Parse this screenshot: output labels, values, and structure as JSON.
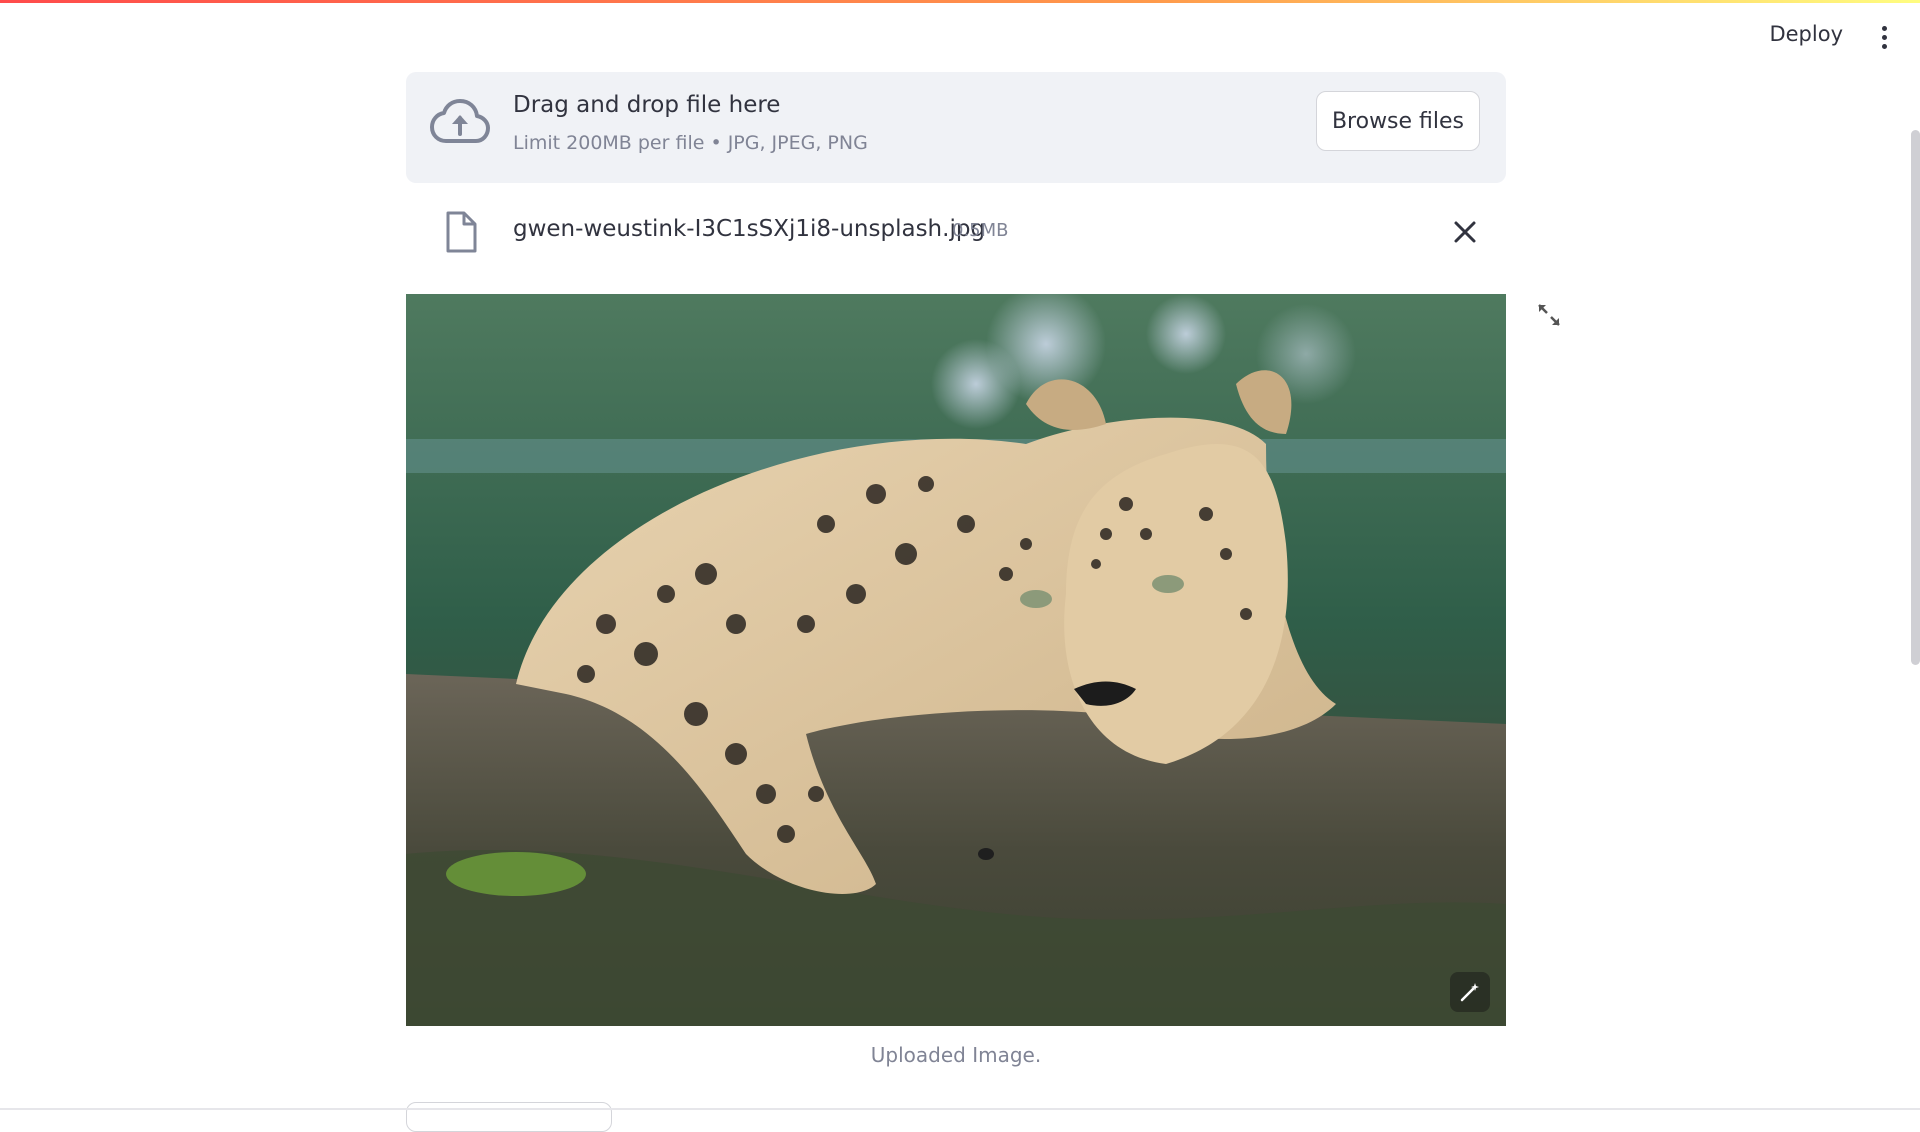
{
  "header": {
    "deploy_label": "Deploy",
    "menu_icon": "kebab-menu-icon"
  },
  "uploader": {
    "icon": "cloud-upload-icon",
    "title": "Drag and drop file here",
    "limits": "Limit 200MB per file • JPG, JPEG, PNG",
    "browse_label": "Browse files"
  },
  "file": {
    "icon": "file-icon",
    "name": "gwen-weustink-I3C1sSXj1i8-unsplash.jpg",
    "size": "0.5MB",
    "remove_icon": "close-icon"
  },
  "image": {
    "alt": "leopard resting on log",
    "caption": "Uploaded Image.",
    "fullscreen_icon": "expand-icon",
    "edit_icon": "magic-wand-icon"
  },
  "colors": {
    "accent_gradient_start": "#ff4b4b",
    "accent_gradient_end": "#fffd80",
    "text": "#31333f",
    "muted_text": "#808495",
    "dropzone_bg": "#f0f2f6"
  }
}
